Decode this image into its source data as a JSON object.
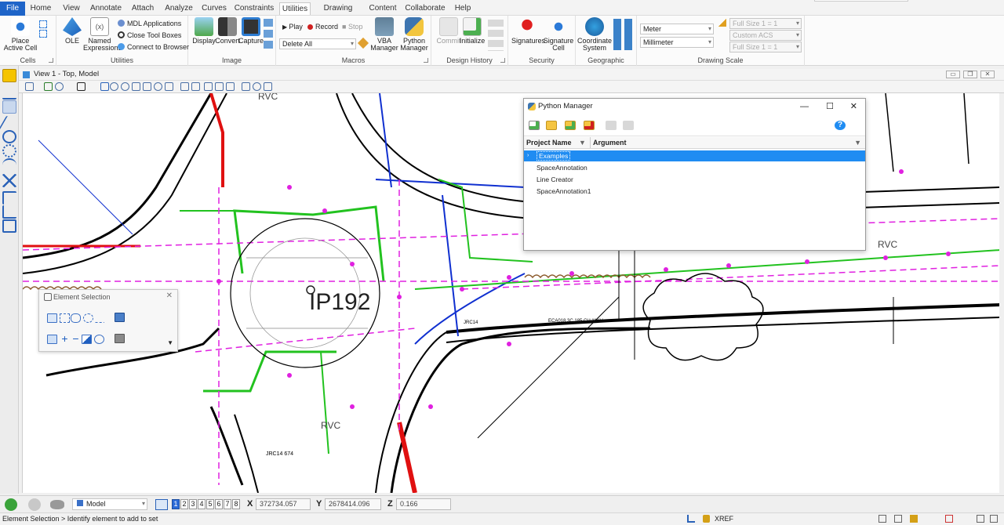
{
  "ribbon": {
    "tabs": [
      "File",
      "Home",
      "View",
      "Annotate",
      "Attach",
      "Analyze",
      "Curves",
      "Constraints",
      "Utilities",
      "Drawing Aids",
      "Content",
      "Collaborate",
      "Help"
    ],
    "active_tab": "Utilities",
    "groups": {
      "cells": {
        "label": "Cells",
        "place_active_cell": "Place Active Cell"
      },
      "utilities": {
        "label": "Utilities",
        "ole": "OLE",
        "named_expressions": "Named Expressions",
        "mdl_applications": "MDL Applications",
        "close_tool_boxes": "Close Tool Boxes",
        "connect_to_browser": "Connect to Browser"
      },
      "image": {
        "label": "Image",
        "display": "Display",
        "convert": "Convert",
        "capture": "Capture"
      },
      "macros": {
        "label": "Macros",
        "play": "Play",
        "record": "Record",
        "stop": "Stop",
        "delete_all": "Delete All",
        "vba_manager": "VBA Manager",
        "python_manager": "Python Manager"
      },
      "design_history": {
        "label": "Design History",
        "commit": "Commit",
        "initialize": "Initialize"
      },
      "security": {
        "label": "Security",
        "signatures": "Signatures",
        "signature_cell": "Signature Cell"
      },
      "geographic": {
        "label": "Geographic",
        "coordinate_system": "Coordinate System"
      },
      "drawing_scale": {
        "label": "Drawing Scale",
        "unit1": "Meter",
        "unit2": "Millimeter",
        "scale1": "Full Size 1 = 1",
        "scale2": "Custom ACS",
        "scale3": "Full Size 1 = 1"
      }
    }
  },
  "view": {
    "title": "View 1 - Top, Model"
  },
  "canvas": {
    "label_ip": "IP192",
    "label_rvc1": "RVC",
    "label_rvc2": "RVC",
    "label_rvc3": "RVC",
    "label_jrc14": "JRC14",
    "label_eca": "ECA018 3C 185 CU 11KV",
    "label_jrc14_674": "JRC14 674"
  },
  "python_manager": {
    "title": "Python Manager",
    "columns": [
      "Project Name",
      "Argument"
    ],
    "rows": [
      {
        "name": "Examples",
        "selected": true
      },
      {
        "name": "SpaceAnnotation",
        "selected": false
      },
      {
        "name": "Line Creator",
        "selected": false
      },
      {
        "name": "SpaceAnnotation1",
        "selected": false
      }
    ]
  },
  "element_selection": {
    "title": "Element Selection"
  },
  "navbar": {
    "model": "Model",
    "views": [
      "1",
      "2",
      "3",
      "4",
      "5",
      "6",
      "7",
      "8"
    ],
    "active_view": "1",
    "x_label": "X",
    "x_value": "372734.057",
    "y_label": "Y",
    "y_value": "2678414.096",
    "z_label": "Z",
    "z_value": "0.166"
  },
  "status": {
    "message": "Element Selection > Identify element to add to set",
    "xref": "XREF"
  },
  "colors": {
    "file_tab": "#1e64c8",
    "selection": "#1f8cf2",
    "green": "#22c21f",
    "magenta": "#e020e0",
    "blue": "#1030d0",
    "red": "#e01010"
  }
}
